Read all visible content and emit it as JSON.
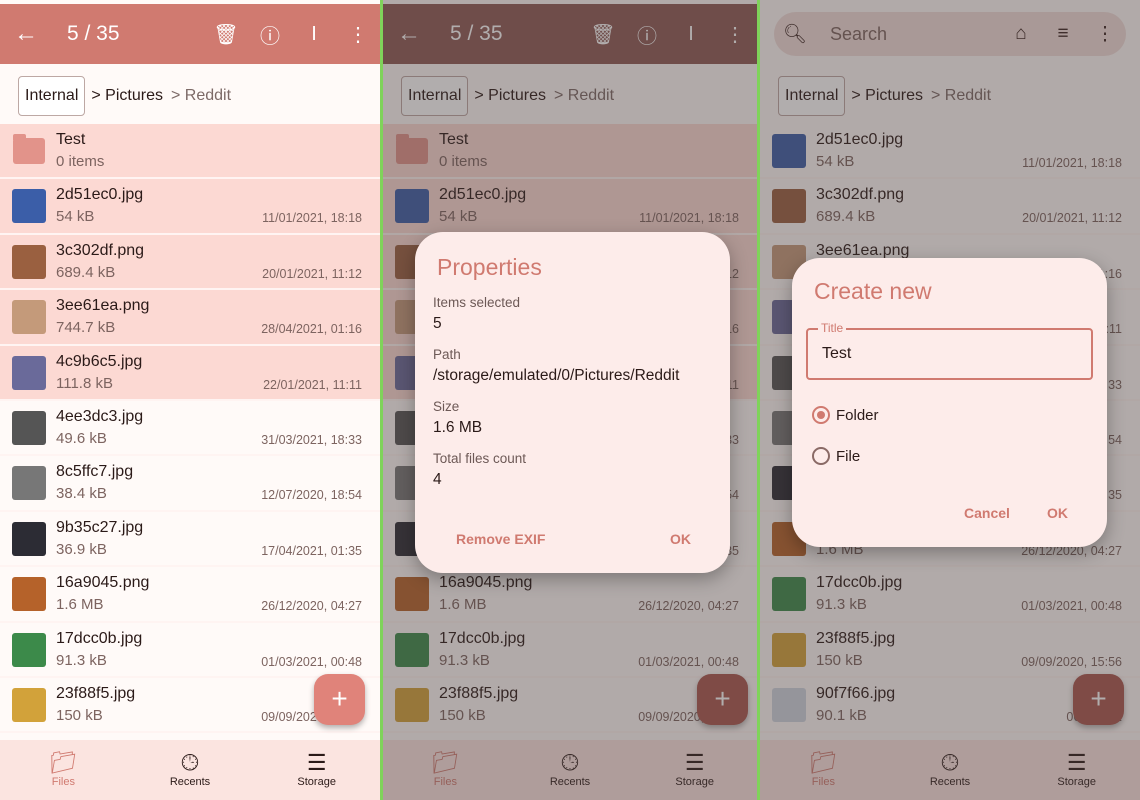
{
  "colors": {
    "accent": "#d07a70",
    "selected_row": "#fcd9d3",
    "divider": "#7fd35a"
  },
  "selection": {
    "count": "5 / 35"
  },
  "search": {
    "placeholder": "Search"
  },
  "breadcrumb": {
    "root": "Internal",
    "mid": "> Pictures",
    "last": "> Reddit"
  },
  "folder": {
    "name": "Test",
    "info": "0 items"
  },
  "files": [
    {
      "name": "2d51ec0.jpg",
      "size": "54 kB",
      "date": "11/01/2021, 18:18",
      "selected": true
    },
    {
      "name": "3c302df.png",
      "size": "689.4 kB",
      "date": "20/01/2021, 11:12",
      "selected": true
    },
    {
      "name": "3ee61ea.png",
      "size": "744.7 kB",
      "date": "28/04/2021, 01:16",
      "selected": true
    },
    {
      "name": "4c9b6c5.jpg",
      "size": "111.8 kB",
      "date": "22/01/2021, 11:11",
      "selected": true
    },
    {
      "name": "4ee3dc3.jpg",
      "size": "49.6 kB",
      "date": "31/03/2021, 18:33",
      "selected": false
    },
    {
      "name": "8c5ffc7.jpg",
      "size": "38.4 kB",
      "date": "12/07/2020, 18:54",
      "selected": false
    },
    {
      "name": "9b35c27.jpg",
      "size": "36.9 kB",
      "date": "17/04/2021, 01:35",
      "selected": false
    },
    {
      "name": "16a9045.png",
      "size": "1.6 MB",
      "date": "26/12/2020, 04:27",
      "selected": false
    },
    {
      "name": "17dcc0b.jpg",
      "size": "91.3 kB",
      "date": "01/03/2021, 00:48",
      "selected": false
    },
    {
      "name": "23f88f5.jpg",
      "size": "150 kB",
      "date": "09/09/2020, 15:56",
      "selected": false
    },
    {
      "name": "90f7f66.jpg",
      "size": "90.1 kB",
      "date": "06/05/202",
      "selected": false
    }
  ],
  "nav": [
    {
      "label": "Files",
      "icon": "folder-icon"
    },
    {
      "label": "Recents",
      "icon": "clock-icon"
    },
    {
      "label": "Storage",
      "icon": "storage-icon"
    }
  ],
  "properties": {
    "title": "Properties",
    "items_label": "Items selected",
    "items": "5",
    "path_label": "Path",
    "path": "/storage/emulated/0/Pictures/Reddit",
    "size_label": "Size",
    "size": "1.6 MB",
    "count_label": "Total files count",
    "count": "4",
    "remove_exif": "Remove EXIF",
    "ok": "OK"
  },
  "create": {
    "title": "Create new",
    "field_label": "Title",
    "field_value": "Test",
    "opt_folder": "Folder",
    "opt_file": "File",
    "selected": "Folder",
    "cancel": "Cancel",
    "ok": "OK"
  }
}
